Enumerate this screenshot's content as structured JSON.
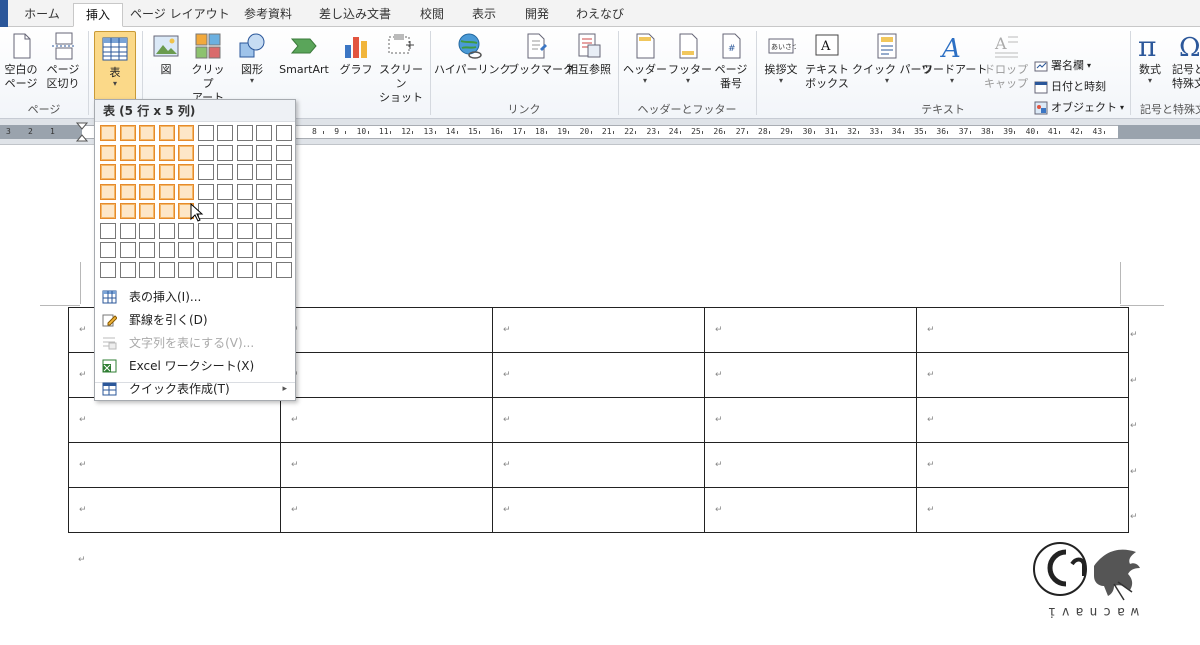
{
  "tabs": [
    {
      "label": "ホーム",
      "active": false
    },
    {
      "label": "挿入",
      "active": true
    },
    {
      "label": "ページ レイアウト",
      "active": false
    },
    {
      "label": "参考資料",
      "active": false
    },
    {
      "label": "差し込み文書",
      "active": false
    },
    {
      "label": "校閲",
      "active": false
    },
    {
      "label": "表示",
      "active": false
    },
    {
      "label": "開発",
      "active": false
    },
    {
      "label": "わえなび",
      "active": false
    }
  ],
  "ribbon": {
    "pages_group": {
      "blank_page": "空白の\nページ",
      "page_break": "ページ\n区切り",
      "label": "ページ"
    },
    "table_group": {
      "table": "表"
    },
    "illustrations": {
      "picture": "図",
      "clipart": "クリップ\nアート",
      "shapes": "図形",
      "smartart": "SmartArt",
      "chart": "グラフ",
      "screenshot": "スクリーン\nショット"
    },
    "links": {
      "hyperlink": "ハイパーリンク",
      "bookmark": "ブックマーク",
      "crossref": "相互参照",
      "label": "リンク"
    },
    "header_footer": {
      "header": "ヘッダー",
      "footer": "フッター",
      "page_number": "ページ\n番号",
      "label": "ヘッダーとフッター"
    },
    "text": {
      "greeting": "挨拶文",
      "textbox": "テキスト\nボックス",
      "quickparts": "クイック パーツ",
      "wordart": "ワードアート",
      "dropcap": "ドロップ\nキャップ",
      "signature": "署名欄",
      "datetime": "日付と時刻",
      "object": "オブジェクト",
      "label": "テキスト"
    },
    "symbols": {
      "equation": "数式",
      "symbol": "記号と\n特殊文字",
      "label": "記号と特殊文字"
    }
  },
  "ruler": {
    "left_numbers": [
      "3",
      "2",
      "1"
    ],
    "numbers": [
      "8",
      "9",
      "10",
      "11",
      "12",
      "13",
      "14",
      "15",
      "16",
      "17",
      "18",
      "19",
      "20",
      "21",
      "22",
      "23",
      "24",
      "25",
      "26",
      "27",
      "28",
      "29",
      "30",
      "31",
      "32",
      "33",
      "34",
      "35",
      "36",
      "37",
      "38",
      "39",
      "40",
      "41",
      "42",
      "43"
    ]
  },
  "dropdown": {
    "header": "表 (5 行 x 5 列)",
    "grid_cols": 10,
    "grid_rows": 8,
    "selected_rows": 5,
    "selected_cols": 5,
    "items": [
      {
        "label": "表の挿入(I)...",
        "icon": "table-icon",
        "disabled": false,
        "submenu": false
      },
      {
        "label": "罫線を引く(D)",
        "icon": "pencil-icon",
        "disabled": false,
        "submenu": false
      },
      {
        "label": "文字列を表にする(V)...",
        "icon": "convert-text-icon",
        "disabled": true,
        "submenu": false
      },
      {
        "label": "Excel ワークシート(X)",
        "icon": "excel-icon",
        "disabled": false,
        "submenu": false
      },
      {
        "label": "クイック表作成(T)",
        "icon": "quick-table-icon",
        "disabled": false,
        "submenu": true
      }
    ]
  },
  "document": {
    "table_rows": 5,
    "table_cols": 5,
    "paragraph_mark": "↵"
  },
  "watermark": {
    "text": "wacnavi"
  },
  "colors": {
    "accent": "#2b579a",
    "selection_orange": "#e58a2c",
    "selection_fill": "#fde6c7",
    "active_button": "#fbd989"
  }
}
